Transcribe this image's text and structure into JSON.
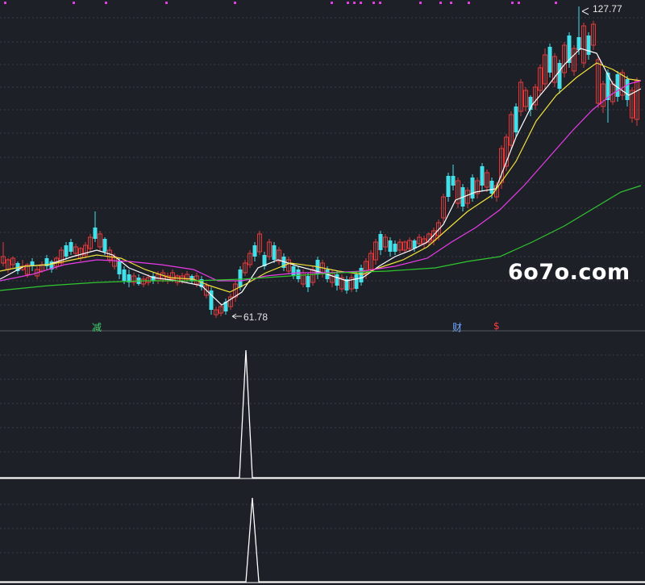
{
  "chart_data": {
    "type": "candlestick",
    "price_high_label": "127.77",
    "price_low_label": "61.78",
    "markers": [
      {
        "label": "减",
        "color": "#3fd16a"
      },
      {
        "label": "财",
        "color": "#6fa8ff"
      },
      {
        "label": "$",
        "color": "#ff3b3b"
      }
    ],
    "moving_averages": [
      {
        "color": "#ffffff"
      },
      {
        "color": "#f2e23a"
      },
      {
        "color": "#e83ce8"
      },
      {
        "color": "#2fc72f"
      }
    ],
    "indicator_panels": 2
  },
  "colors": {
    "background": "#1e2028",
    "up_candle": "#e03a3a",
    "down_candle": "#43e0ea",
    "grid": "#3a3c46",
    "indicator_line": "#ffffff",
    "top_dots": "#e040e0"
  },
  "watermark": "6o7o.com"
}
